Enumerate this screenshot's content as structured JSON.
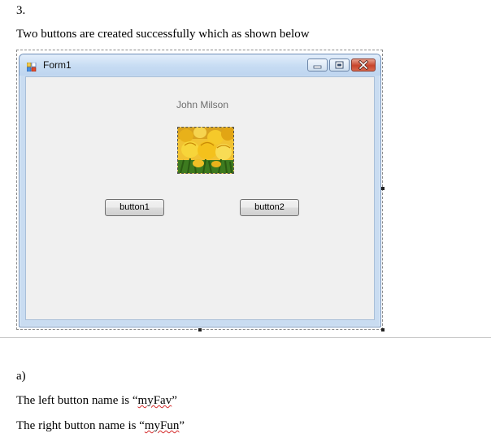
{
  "doc": {
    "step_number": "3.",
    "intro_text": "Two buttons are created successfully which as shown below",
    "part_label": "a)",
    "left_button_text_prefix": "The left button name is “",
    "left_button_name": "myFav",
    "left_button_text_suffix": "”",
    "right_button_text_prefix": "The right button name is “",
    "right_button_name": "myFun",
    "right_button_text_suffix": "”"
  },
  "form": {
    "title": "Form1",
    "label_text": "John Milson",
    "picture_icon": "tulips-image",
    "button1_label": "button1",
    "button2_label": "button2",
    "caption_icons": [
      "minimize-icon",
      "maximize-icon",
      "close-icon"
    ]
  },
  "colors": {
    "spellcheck_underline": "#d42a2a",
    "close_button": "#c7442c",
    "title_bar": "#c7dcf3"
  }
}
